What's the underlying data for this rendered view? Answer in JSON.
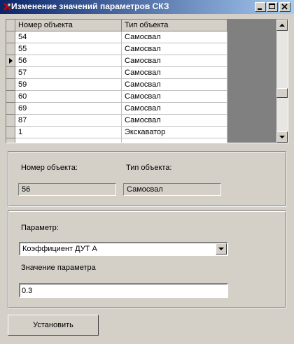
{
  "window": {
    "title": "Изменение значений параметров СКЗ",
    "icon": "app-icon",
    "title_gradient": [
      "#0a246a",
      "#a6caf0"
    ],
    "caption_buttons": [
      "minimize-icon",
      "maximize-icon",
      "close-icon"
    ]
  },
  "grid": {
    "columns": [
      "Номер объекта",
      "Тип объекта"
    ],
    "rows": [
      {
        "number": "54",
        "type": "Самосвал"
      },
      {
        "number": "55",
        "type": "Самосвал"
      },
      {
        "number": "56",
        "type": "Самосвал"
      },
      {
        "number": "57",
        "type": "Самосвал"
      },
      {
        "number": "59",
        "type": "Самосвал"
      },
      {
        "number": "60",
        "type": "Самосвал"
      },
      {
        "number": "69",
        "type": "Самосвал"
      },
      {
        "number": "87",
        "type": "Самосвал"
      },
      {
        "number": "1",
        "type": "Экскаватор"
      }
    ],
    "current_row_marker": "row-pointer-icon"
  },
  "object_info": {
    "number_label": "Номер объекта:",
    "type_label": "Тип объекта:",
    "number_value": "56",
    "type_value": "Самосвал"
  },
  "parameter": {
    "label": "Параметр:",
    "selected": "Коэффициент ДУТ А",
    "value_label": "Значение параметра",
    "value": "0.3"
  },
  "actions": {
    "set_label": "Установить"
  }
}
